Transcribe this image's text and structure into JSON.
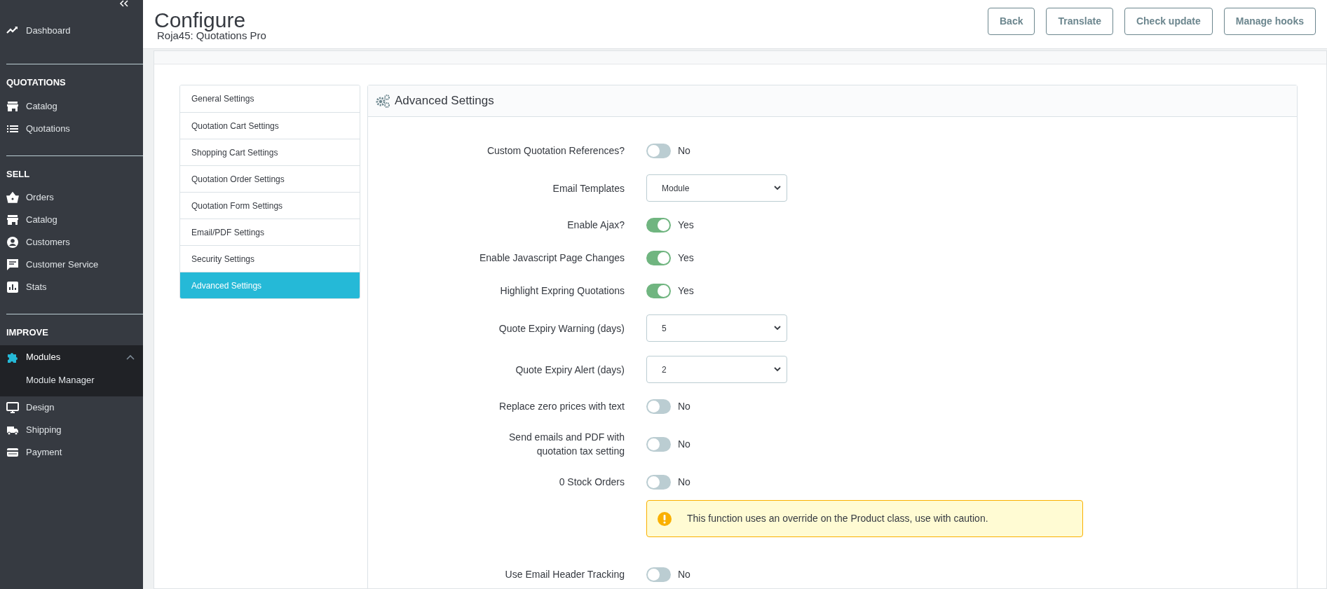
{
  "sidebar": {
    "groups": [
      {
        "items": [
          {
            "label": "Dashboard",
            "selected": false
          }
        ]
      },
      {
        "title": "QUOTATIONS",
        "items": [
          {
            "label": "Catalog",
            "selected": false
          },
          {
            "label": "Quotations",
            "selected": false
          }
        ]
      },
      {
        "title": "SELL",
        "items": [
          {
            "label": "Orders",
            "selected": false
          },
          {
            "label": "Catalog",
            "selected": false
          },
          {
            "label": "Customers",
            "selected": false
          },
          {
            "label": "Customer Service",
            "selected": false
          },
          {
            "label": "Stats",
            "selected": false
          }
        ]
      },
      {
        "title": "IMPROVE",
        "items": [
          {
            "label": "Modules",
            "selected": true,
            "expanded": true,
            "children": [
              {
                "label": "Module Manager"
              }
            ]
          },
          {
            "label": "Design",
            "selected": false
          },
          {
            "label": "Shipping",
            "selected": false
          },
          {
            "label": "Payment",
            "selected": false
          }
        ]
      }
    ]
  },
  "header": {
    "title": "Configure",
    "subtitle": "Roja45: Quotations Pro",
    "buttons": [
      "Back",
      "Translate",
      "Check update",
      "Manage hooks"
    ]
  },
  "settings_nav": [
    {
      "label": "General Settings",
      "selected": false
    },
    {
      "label": "Quotation Cart Settings",
      "selected": false
    },
    {
      "label": "Shopping Cart Settings",
      "selected": false
    },
    {
      "label": "Quotation Order Settings",
      "selected": false
    },
    {
      "label": "Quotation Form Settings",
      "selected": false
    },
    {
      "label": "Email/PDF Settings",
      "selected": false
    },
    {
      "label": "Security Settings",
      "selected": false
    },
    {
      "label": "Advanced Settings",
      "selected": true
    }
  ],
  "panel": {
    "title": "Advanced Settings",
    "rows": [
      {
        "kind": "toggle",
        "label": "Custom Quotation References?",
        "on": false,
        "state_text": "No"
      },
      {
        "kind": "select",
        "label": "Email Templates",
        "value": "Module"
      },
      {
        "kind": "toggle",
        "label": "Enable Ajax?",
        "on": true,
        "state_text": "Yes"
      },
      {
        "kind": "toggle",
        "label": "Enable Javascript Page Changes",
        "on": true,
        "state_text": "Yes"
      },
      {
        "kind": "toggle",
        "label": "Highlight Expring Quotations",
        "on": true,
        "state_text": "Yes"
      },
      {
        "kind": "select",
        "label": "Quote Expiry Warning (days)",
        "value": "5"
      },
      {
        "kind": "select",
        "label": "Quote Expiry Alert (days)",
        "value": "2"
      },
      {
        "kind": "toggle",
        "label": "Replace zero prices with text",
        "on": false,
        "state_text": "No"
      },
      {
        "kind": "toggle",
        "label": "Send emails and PDF with quotation tax setting",
        "on": false,
        "state_text": "No"
      },
      {
        "kind": "toggle",
        "label": "0 Stock Orders",
        "on": false,
        "state_text": "No"
      },
      {
        "kind": "alert",
        "text": "This function uses an override on the Product class, use with caution."
      },
      {
        "kind": "toggle",
        "label": "Use Email Header Tracking",
        "on": false,
        "state_text": "No"
      }
    ]
  }
}
